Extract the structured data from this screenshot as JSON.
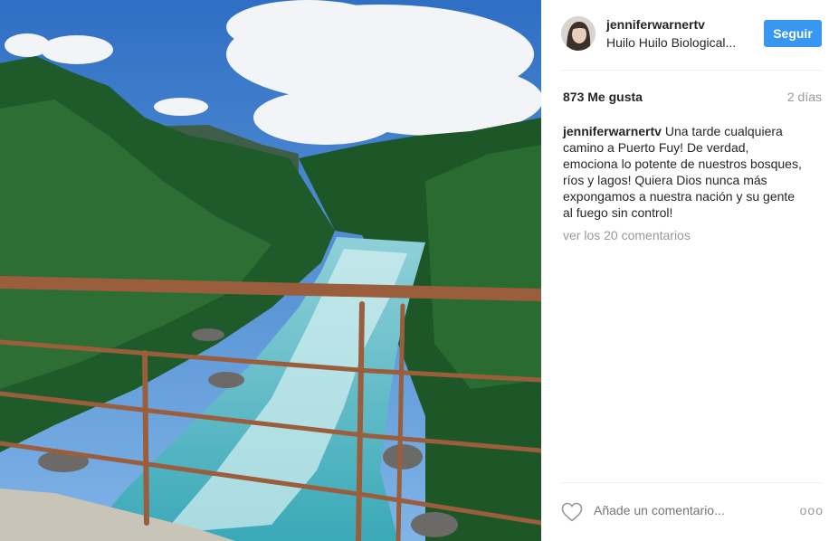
{
  "post": {
    "image_alt_icon": "landscape-photo",
    "user": {
      "username": "jenniferwarnertv",
      "location": "Huilo Huilo Biological..."
    },
    "follow_label": "Seguir",
    "likes_text": "873 Me gusta",
    "time_text": "2 días",
    "caption": {
      "username": "jenniferwarnertv",
      "text": " Una tarde cualquiera camino a Puerto Fuy! De verdad, emociona lo potente de nuestros bosques, ríos y lagos! Quiera Dios nunca más expongamos a nuestra nación y su gente al fuego sin control!"
    },
    "view_comments": "ver los 20 comentarios",
    "comment_placeholder": "Añade un comentario...",
    "more_label": "ooo",
    "colors": {
      "accent": "#3897f0",
      "muted": "#999999",
      "text": "#262626"
    }
  }
}
